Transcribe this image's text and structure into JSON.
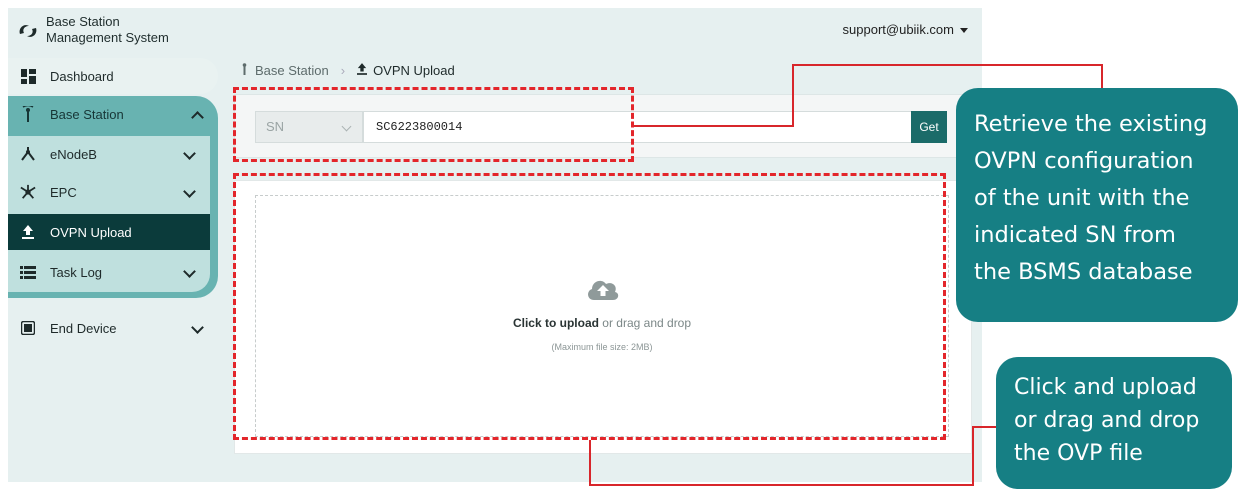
{
  "header": {
    "app_title_line1": "Base Station",
    "app_title_line2": "Management System",
    "user_email": "support@ubiik.com"
  },
  "sidebar": {
    "items": [
      {
        "label": "Dashboard"
      },
      {
        "label": "Base Station"
      },
      {
        "label": "eNodeB"
      },
      {
        "label": "EPC"
      },
      {
        "label": "OVPN Upload"
      },
      {
        "label": "Task Log"
      },
      {
        "label": "End Device"
      }
    ]
  },
  "breadcrumb": {
    "root": "Base Station",
    "current": "OVPN Upload"
  },
  "lookup": {
    "field_select": "SN",
    "sn_value": "SC6223800014",
    "get_label": "Get"
  },
  "upload": {
    "click_label": "Click to upload",
    "drag_label": " or drag and drop",
    "hint": "(Maximum file size: 2MB)"
  },
  "annotations": {
    "callout1": [
      "Retrieve the existing",
      "OVPN configuration",
      "of  the unit with the",
      "indicated SN from",
      "the BSMS database"
    ],
    "callout2": [
      "Click and upload",
      "or drag and drop",
      "the OVP file"
    ],
    "highlight_color": "#e3262b",
    "callout_color": "#167f84",
    "accent_color": "#0b3b3b"
  }
}
